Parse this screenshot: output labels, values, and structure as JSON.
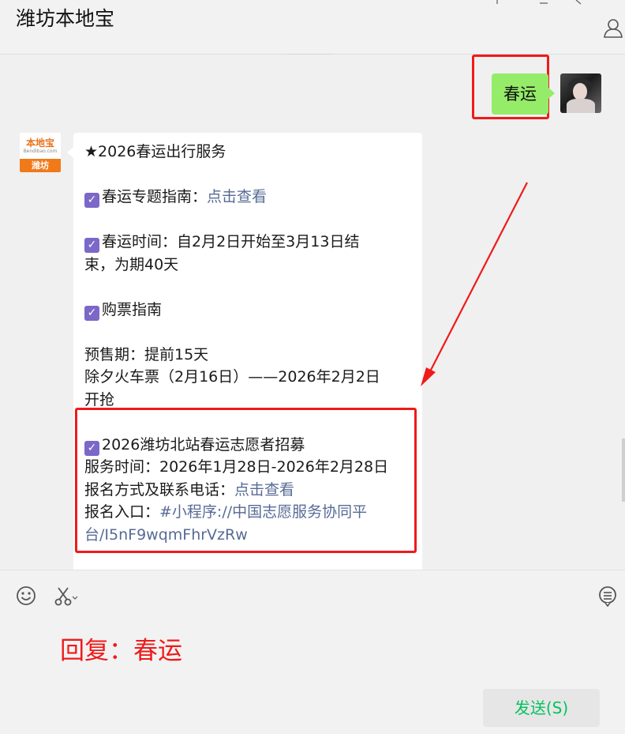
{
  "header": {
    "title": "潍坊本地宝"
  },
  "sent": {
    "text": "春运"
  },
  "bot": {
    "avatar_brand": "本地宝",
    "avatar_sub": "Bendibao.com",
    "avatar_city": "潍坊"
  },
  "message": {
    "line1": "★2026春运出行服务",
    "guide_label": "春运专题指南：",
    "guide_link": "点击查看",
    "time_label_1": "春运时间：自2月2日开始至3月13日结",
    "time_label_2": "束，为期40天",
    "ticket_title": "购票指南",
    "presale": "预售期：提前15天",
    "eve_ticket_1": "除夕火车票（2月16日）——2026年2月2日",
    "eve_ticket_2": "开抢",
    "volunteer_title": "2026潍坊北站春运志愿者招募",
    "service_time": "服务时间：2026年1月28日-2026年2月28日",
    "signup_label": "报名方式及联系电话：",
    "signup_link": "点击查看",
    "entry_label": "报名入口：",
    "entry_link_1": "#小程序://中国志愿服务协同平",
    "entry_link_2": "台/I5nF9wqmFhrVzRw"
  },
  "input": {
    "reply_text": "回复：春运",
    "send_label": "发送(S)"
  },
  "colors": {
    "sent_bubble": "#95ec69",
    "link": "#576b95",
    "highlight_red": "#f01a1a",
    "checkbox": "#7b68c8",
    "send_text": "#07c160",
    "brand_orange": "#f07a1a"
  }
}
